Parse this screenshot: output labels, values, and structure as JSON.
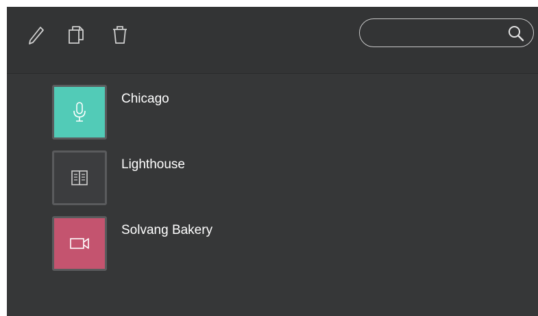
{
  "toolbar": {
    "edit_icon": "pencil-icon",
    "copy_icon": "copy-icon",
    "delete_icon": "trash-icon"
  },
  "search": {
    "value": "",
    "placeholder": "",
    "icon": "search-icon"
  },
  "items": [
    {
      "title": "Chicago",
      "type_icon": "microphone-icon",
      "color": "#52cbb7"
    },
    {
      "title": "Lighthouse",
      "type_icon": "book-icon",
      "color": "#3c3d3f"
    },
    {
      "title": "Solvang Bakery",
      "type_icon": "video-camera-icon",
      "color": "#c4546f"
    }
  ],
  "colors": {
    "background": "#363738",
    "toolbar": "#333435",
    "icon": "#cfcfcf",
    "text": "#ffffff"
  }
}
